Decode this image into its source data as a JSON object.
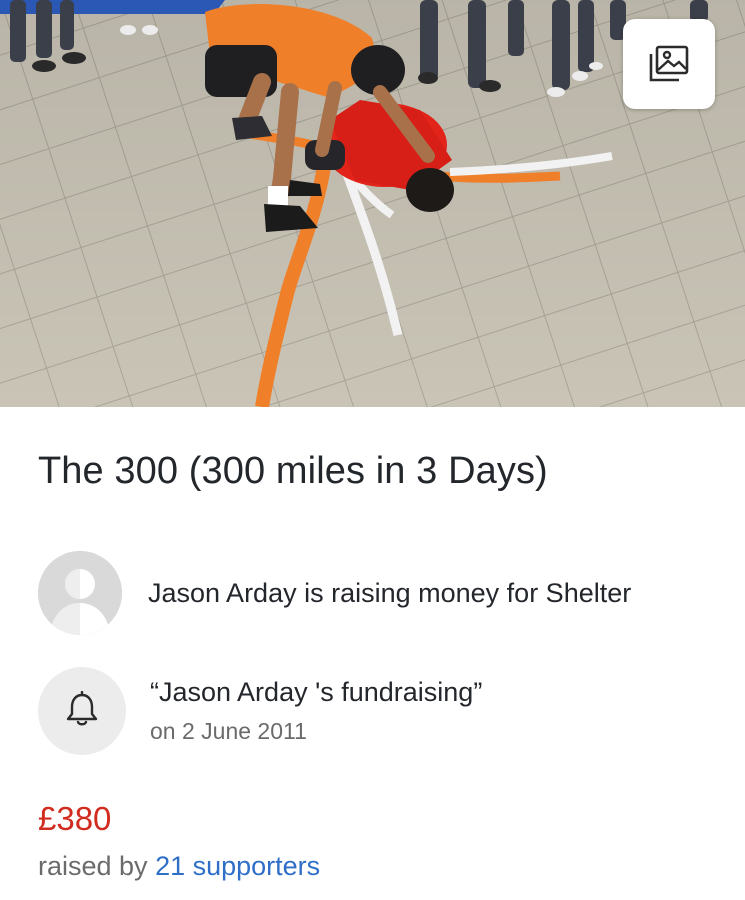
{
  "hero": {
    "icons": {
      "gallery": "gallery-icon"
    }
  },
  "page": {
    "title": "The 300 (300 miles in 3 Days)"
  },
  "organizer": {
    "avatar_icon": "default-avatar-icon",
    "text": "Jason Arday is raising money for Shelter"
  },
  "event": {
    "icon": "bell-icon",
    "name": "“Jason Arday 's fundraising”",
    "date": "on 2 June 2011"
  },
  "totals": {
    "amount": "£380",
    "raised_prefix": "raised by",
    "supporters_link": "21 supporters"
  },
  "colors": {
    "amount": "#d22b1f",
    "link": "#2f6fc7"
  }
}
